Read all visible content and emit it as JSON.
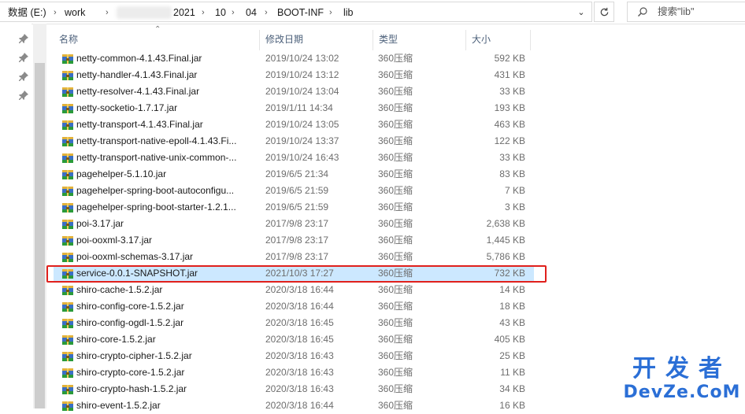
{
  "address_bar": {
    "crumbs": [
      "数据 (E:)",
      "work",
      "2021",
      "10",
      "04",
      "BOOT-INF",
      "lib"
    ],
    "separator": "›"
  },
  "search": {
    "placeholder": "搜索\"lib\""
  },
  "columns": {
    "name": "名称",
    "date": "修改日期",
    "type": "类型",
    "size": "大小"
  },
  "files": [
    {
      "name": "netty-common-4.1.43.Final.jar",
      "date": "2019/10/24 13:02",
      "type": "360压缩",
      "size": "592 KB"
    },
    {
      "name": "netty-handler-4.1.43.Final.jar",
      "date": "2019/10/24 13:12",
      "type": "360压缩",
      "size": "431 KB"
    },
    {
      "name": "netty-resolver-4.1.43.Final.jar",
      "date": "2019/10/24 13:04",
      "type": "360压缩",
      "size": "33 KB"
    },
    {
      "name": "netty-socketio-1.7.17.jar",
      "date": "2019/1/11 14:34",
      "type": "360压缩",
      "size": "193 KB"
    },
    {
      "name": "netty-transport-4.1.43.Final.jar",
      "date": "2019/10/24 13:05",
      "type": "360压缩",
      "size": "463 KB"
    },
    {
      "name": "netty-transport-native-epoll-4.1.43.Fi...",
      "date": "2019/10/24 13:37",
      "type": "360压缩",
      "size": "122 KB"
    },
    {
      "name": "netty-transport-native-unix-common-...",
      "date": "2019/10/24 16:43",
      "type": "360压缩",
      "size": "33 KB"
    },
    {
      "name": "pagehelper-5.1.10.jar",
      "date": "2019/6/5 21:34",
      "type": "360压缩",
      "size": "83 KB"
    },
    {
      "name": "pagehelper-spring-boot-autoconfigu...",
      "date": "2019/6/5 21:59",
      "type": "360压缩",
      "size": "7 KB"
    },
    {
      "name": "pagehelper-spring-boot-starter-1.2.1...",
      "date": "2019/6/5 21:59",
      "type": "360压缩",
      "size": "3 KB"
    },
    {
      "name": "poi-3.17.jar",
      "date": "2017/9/8 23:17",
      "type": "360压缩",
      "size": "2,638 KB"
    },
    {
      "name": "poi-ooxml-3.17.jar",
      "date": "2017/9/8 23:17",
      "type": "360压缩",
      "size": "1,445 KB"
    },
    {
      "name": "poi-ooxml-schemas-3.17.jar",
      "date": "2017/9/8 23:17",
      "type": "360压缩",
      "size": "5,786 KB"
    },
    {
      "name": "service-0.0.1-SNAPSHOT.jar",
      "date": "2021/10/3 17:27",
      "type": "360压缩",
      "size": "732 KB",
      "selected": true
    },
    {
      "name": "shiro-cache-1.5.2.jar",
      "date": "2020/3/18 16:44",
      "type": "360压缩",
      "size": "14 KB"
    },
    {
      "name": "shiro-config-core-1.5.2.jar",
      "date": "2020/3/18 16:44",
      "type": "360压缩",
      "size": "18 KB"
    },
    {
      "name": "shiro-config-ogdl-1.5.2.jar",
      "date": "2020/3/18 16:45",
      "type": "360压缩",
      "size": "43 KB"
    },
    {
      "name": "shiro-core-1.5.2.jar",
      "date": "2020/3/18 16:45",
      "type": "360压缩",
      "size": "405 KB"
    },
    {
      "name": "shiro-crypto-cipher-1.5.2.jar",
      "date": "2020/3/18 16:43",
      "type": "360压缩",
      "size": "25 KB"
    },
    {
      "name": "shiro-crypto-core-1.5.2.jar",
      "date": "2020/3/18 16:43",
      "type": "360压缩",
      "size": "11 KB"
    },
    {
      "name": "shiro-crypto-hash-1.5.2.jar",
      "date": "2020/3/18 16:43",
      "type": "360压缩",
      "size": "34 KB"
    },
    {
      "name": "shiro-event-1.5.2.jar",
      "date": "2020/3/18 16:44",
      "type": "360压缩",
      "size": "16 KB"
    }
  ],
  "watermark": {
    "line1": "开发者",
    "line2": "DevZe.CoM"
  },
  "colors": {
    "selection": "#cce8ff",
    "highlight_box": "#e0201c",
    "watermark": "#2b6fd6"
  }
}
